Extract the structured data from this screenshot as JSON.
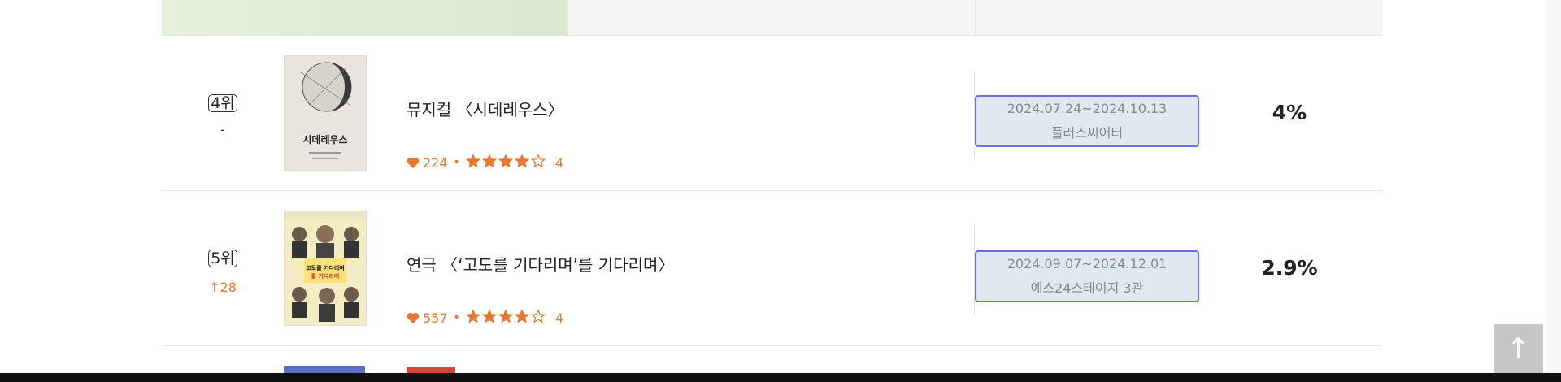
{
  "colors": {
    "accent": "#e8772f",
    "period_border": "#6c6cf0",
    "period_bg": "#dfe9f0",
    "header_green": "#e3efd9"
  },
  "rows": [
    {
      "rank": "4위",
      "change": "-",
      "change_dir": "none",
      "title": "뮤지컬 〈시데레우스〉",
      "likes": "224",
      "rating_stars": 4,
      "rating": "4",
      "period": "2024.07.24~2024.10.13",
      "venue": "플러스씨어터",
      "share": "4%",
      "poster_text": "시데레우스"
    },
    {
      "rank": "5위",
      "change": "↑28",
      "change_dir": "up",
      "title": "연극 〈‘고도를 기다리며’를 기다리며〉",
      "likes": "557",
      "rating_stars": 4,
      "rating": "4",
      "period": "2024.09.07~2024.12.01",
      "venue": "예스24스테이지 3관",
      "share": "2.9%",
      "poster_text": "고도를 기다리며를 기다리며"
    }
  ],
  "scroll_top": {
    "icon": "arrow-up-icon",
    "glyph": "↑"
  }
}
